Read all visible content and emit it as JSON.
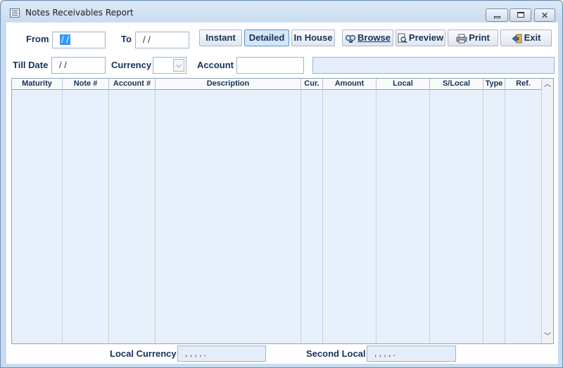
{
  "window": {
    "title": "Notes Receivables Report"
  },
  "filters": {
    "from_label": "From",
    "from_value": "/ /",
    "to_label": "To",
    "to_value": "/ /",
    "till_date_label": "Till Date",
    "till_date_value": "/ /",
    "currency_label": "Currency",
    "currency_value": "",
    "account_label": "Account",
    "account_value": "",
    "account_name_value": ""
  },
  "toolbar": {
    "instant": "Instant",
    "detailed": "Detailed",
    "in_house": "In House",
    "browse": "Browse",
    "preview": "Preview",
    "print": "Print",
    "exit": "Exit"
  },
  "grid": {
    "columns": [
      "Maturity",
      "Note #",
      "Account #",
      "Description",
      "Cur.",
      "Amount",
      "Local",
      "S/Local",
      "Type",
      "Ref."
    ],
    "rows": []
  },
  "totals": {
    "local_currency_label": "Local Currency",
    "local_currency_value": ",   ,   ,   ,   .",
    "second_local_label": "Second Local",
    "second_local_value": ",   ,   ,   ,   ."
  },
  "colors": {
    "accent": "#15325b",
    "grid_bg": "#e8f1fb",
    "active_tab": "#d5e6f6"
  },
  "icons": [
    "app-menu-icon",
    "minimize-icon",
    "maximize-icon",
    "close-icon",
    "dropdown-chevron-icon",
    "browse-icon",
    "preview-icon",
    "print-icon",
    "exit-icon",
    "scroll-up-icon",
    "scroll-down-icon"
  ]
}
